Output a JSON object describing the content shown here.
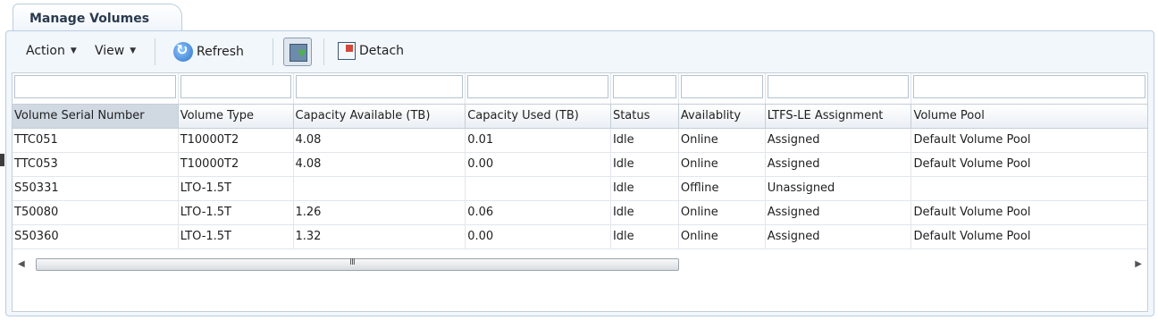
{
  "panel": {
    "tab_title": "Manage Volumes"
  },
  "toolbar": {
    "action_label": "Action",
    "view_label": "View",
    "refresh_label": "Refresh",
    "detach_label": "Detach",
    "icons": {
      "refresh": "refresh-icon",
      "filter": "query-by-example-icon",
      "detach": "detach-icon"
    }
  },
  "table": {
    "columns": [
      "Volume Serial Number",
      "Volume Type",
      "Capacity Available (TB)",
      "Capacity Used (TB)",
      "Status",
      "Availablity",
      "LTFS-LE Assignment",
      "Volume Pool"
    ],
    "rows": [
      [
        "TTC051",
        "T10000T2",
        "4.08",
        "0.01",
        "Idle",
        "Online",
        "Assigned",
        "Default Volume Pool"
      ],
      [
        "TTC053",
        "T10000T2",
        "4.08",
        "0.00",
        "Idle",
        "Online",
        "Assigned",
        "Default Volume Pool"
      ],
      [
        "S50331",
        "LTO-1.5T",
        "",
        "",
        "Idle",
        "Offline",
        "Unassigned",
        ""
      ],
      [
        "T50080",
        "LTO-1.5T",
        "1.26",
        "0.06",
        "Idle",
        "Online",
        "Assigned",
        "Default Volume Pool"
      ],
      [
        "S50360",
        "LTO-1.5T",
        "1.32",
        "0.00",
        "Idle",
        "Online",
        "Assigned",
        "Default Volume Pool"
      ]
    ]
  },
  "scrollbar": {
    "grip": "III"
  }
}
